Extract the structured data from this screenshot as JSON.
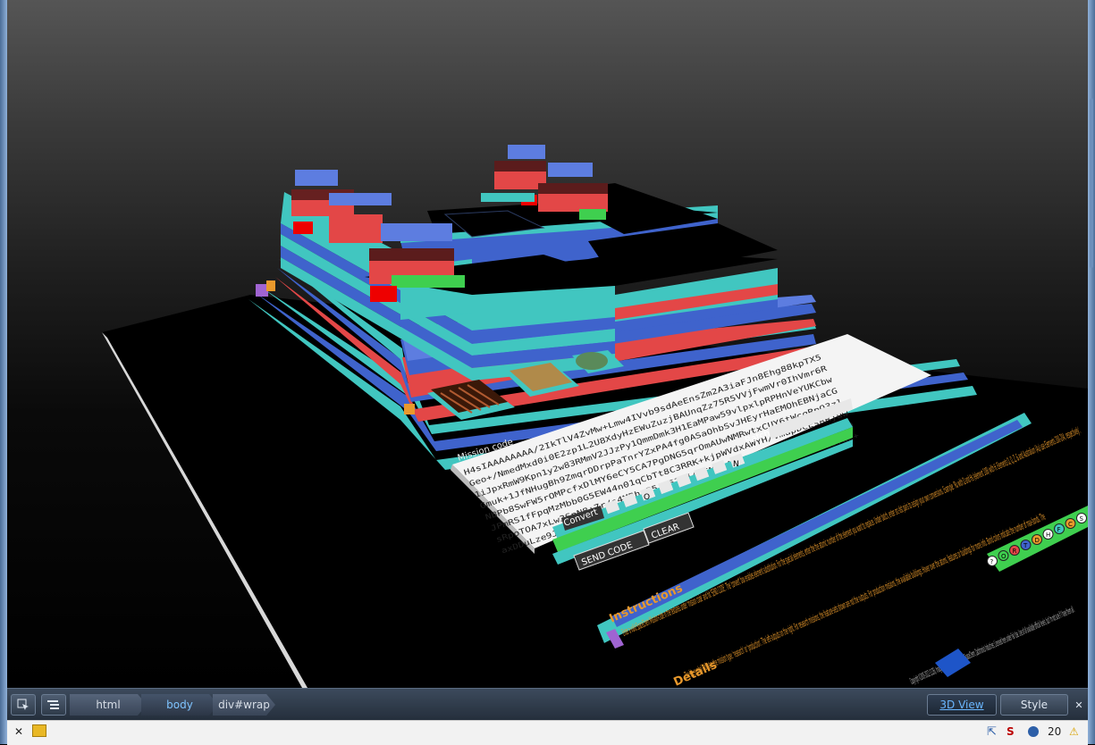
{
  "scene": {
    "panel_tabs": [
      "Mission code"
    ],
    "mission_code_lines": [
      "H4sIAAAAAAAA/2IkTlV4ZvMw+Lmw4IVvb9sdAeEnsZm2A3iaFJn8Ehg88kpTX5",
      "Geo+/NmedMxd0i0E2zp1L2U8XdyHzEWuZuzjBAUnqZz75R5VVjFwmVr0IhVmr6R",
      "1iJpxRmW9Kpn1y2w83RMmV2JJzPy1QmmDmk3H1EaMPaw59vlpxlpRPHnVeYUKCbw",
      "Gmuk+1JfNHugBh9ZmqrDDrpPaTnrYZxPA4fg0ASaOhbSvJHEyrHaEMOhEBNjaCG",
      "NBPb8SwFW5rOMPcfxDlMY6eCY5CA7PgDNG5qrOmAUwNMRwtxCUY6tWcgRpO3zl",
      "JPmRS1fFpqMzMbb0G5EW44n01qCbTt8C3RRK+kjpWVdxAWYH/VmupDCEsRRjuw",
      "sRpoTOA7xLw3SnN8+7r/s4MBhrF5JL57Ej4p6MgAANwAAA6m7qmwGBtBpstxLh",
      "axDDuLze9Jgaa9YvE3Oj9dwB6UI6sWn5MI6AlyrwhrCIW//JgakUFJaXt2E9YWE+"
    ],
    "batch_label": "Batch",
    "send_code_label": "SEND CODE",
    "clear_label": "CLEAR",
    "convert_label": "Convert",
    "convert_cells": [
      "",
      "",
      "O",
      "",
      "",
      "",
      "",
      "N"
    ],
    "symbol_row": [
      "?",
      "O",
      "R",
      "T",
      "D",
      "H",
      "F",
      "C",
      "S"
    ],
    "instructions_heading": "Instructions",
    "instructions_text": "Enter a valid SpaceChem Mission-code in the textarea under 'mission code' and hit 'SEND CODE'. The 'convert' box enables element substitution. For the special elements, enter the the atomic number of the element you want to replace. Under batch, enter src-dst pairs to assign your own conversions. Example: 'Ru with Ω and Hs (element 108) with H. Elements Ω, Q, Z, & and Australium (Au) use Elements 200-204, respectively'.",
    "details_heading": "Details",
    "details_text": "The big symbol indicates the mission type: 'research' or 'production'. The left-outputs on the right. For research missions, the feature-sets shown are not the outputs. For production missions, the available buildings. Hover over the atoms, features or buildings for more info. Bond colors indicate the number of max-bonds. The",
    "footer_text": "Copyright ©2005-2012 (1126). Images used here were taken from SpaceChem; Zachtronics Industries; Licensed here under Fair Use. Use of all available official levels, but I'm not sure if I have them all.",
    "colors": {
      "teal": "#41c6c0",
      "blue": "#3f63cc",
      "red": "#e34747",
      "green": "#3fcf4f",
      "orange": "#e9992c",
      "sky": "#5d7de0",
      "floor": "#000000"
    }
  },
  "devtools": {
    "inspect_icon": "cursor-select-icon",
    "dom_icon": "dom-tree-icon",
    "breadcrumbs": [
      "html",
      "body",
      "div#wrap"
    ],
    "view_3d_label": "3D View",
    "style_label": "Style",
    "close_icon": "close-icon",
    "status_count": "20"
  }
}
